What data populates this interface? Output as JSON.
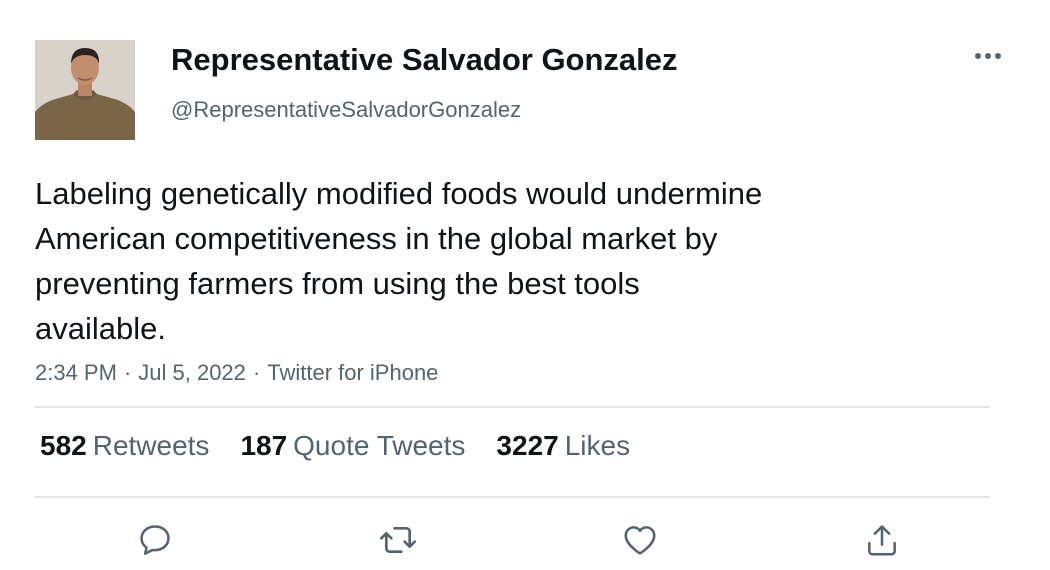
{
  "author": {
    "display_name": "Representative Salvador Gonzalez",
    "handle": "@RepresentativeSalvadorGonzalez"
  },
  "tweet": {
    "lines": [
      "Labeling genetically modified foods would undermine",
      "American competitiveness in the global market by",
      "preventing farmers from using the best tools",
      "available."
    ],
    "time": "2:34 PM",
    "date": "Jul 5, 2022",
    "source": "Twitter for iPhone",
    "separator": "·"
  },
  "stats": {
    "retweets": {
      "count": "582",
      "label": "Retweets"
    },
    "quotes": {
      "count": "187",
      "label": "Quote Tweets"
    },
    "likes": {
      "count": "3227",
      "label": "Likes"
    }
  },
  "icons": {
    "more": "more-horizontal-icon",
    "reply": "reply-icon",
    "retweet": "retweet-icon",
    "like": "heart-icon",
    "share": "share-icon"
  },
  "colors": {
    "text": "#0f1419",
    "secondary": "#536471",
    "divider": "#e1e5e8"
  }
}
